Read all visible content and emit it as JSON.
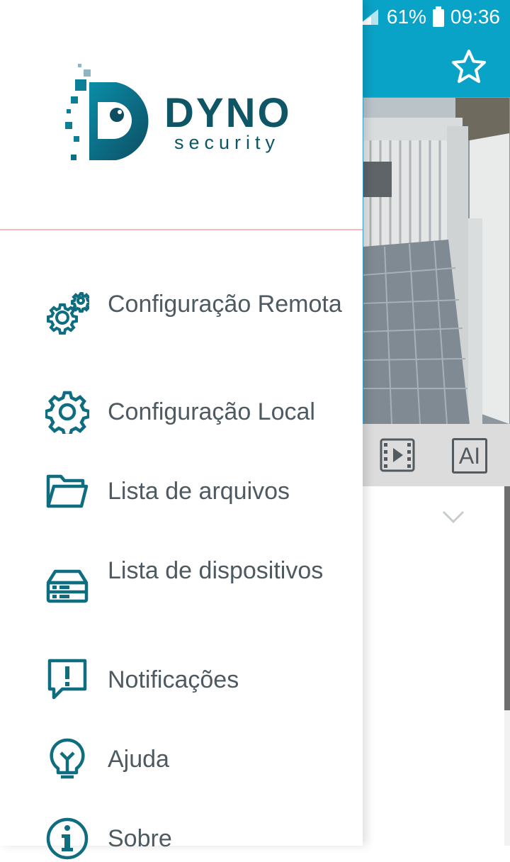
{
  "status_bar": {
    "battery": "61%",
    "time": "09:36"
  },
  "drawer": {
    "logo": {
      "title": "DYNO",
      "subtitle": "security"
    },
    "menu": [
      {
        "label": "Configuração Remota",
        "icon": "gears-icon"
      },
      {
        "label": "Configuração Local",
        "icon": "gear-icon"
      },
      {
        "label": "Lista de arquivos",
        "icon": "folder-icon"
      },
      {
        "label": "Lista de dispositivos",
        "icon": "dvr-device-icon"
      },
      {
        "label": "Notificações",
        "icon": "alert-message-icon"
      },
      {
        "label": "Ajuda",
        "icon": "lightbulb-icon"
      },
      {
        "label": "Sobre",
        "icon": "info-icon"
      }
    ]
  },
  "background_app": {
    "camera_toolbar": {
      "ai_label": "AI"
    },
    "icons": [
      "star-icon",
      "video-playback-icon",
      "ai-icon",
      "chevron-down-icon"
    ]
  },
  "colors": {
    "app_bar": "#0aa3c8",
    "brand_dark": "#0e5566",
    "icon_teal": "#0f6d80",
    "menu_text": "#4e5a61",
    "divider": "#f3b9be"
  }
}
